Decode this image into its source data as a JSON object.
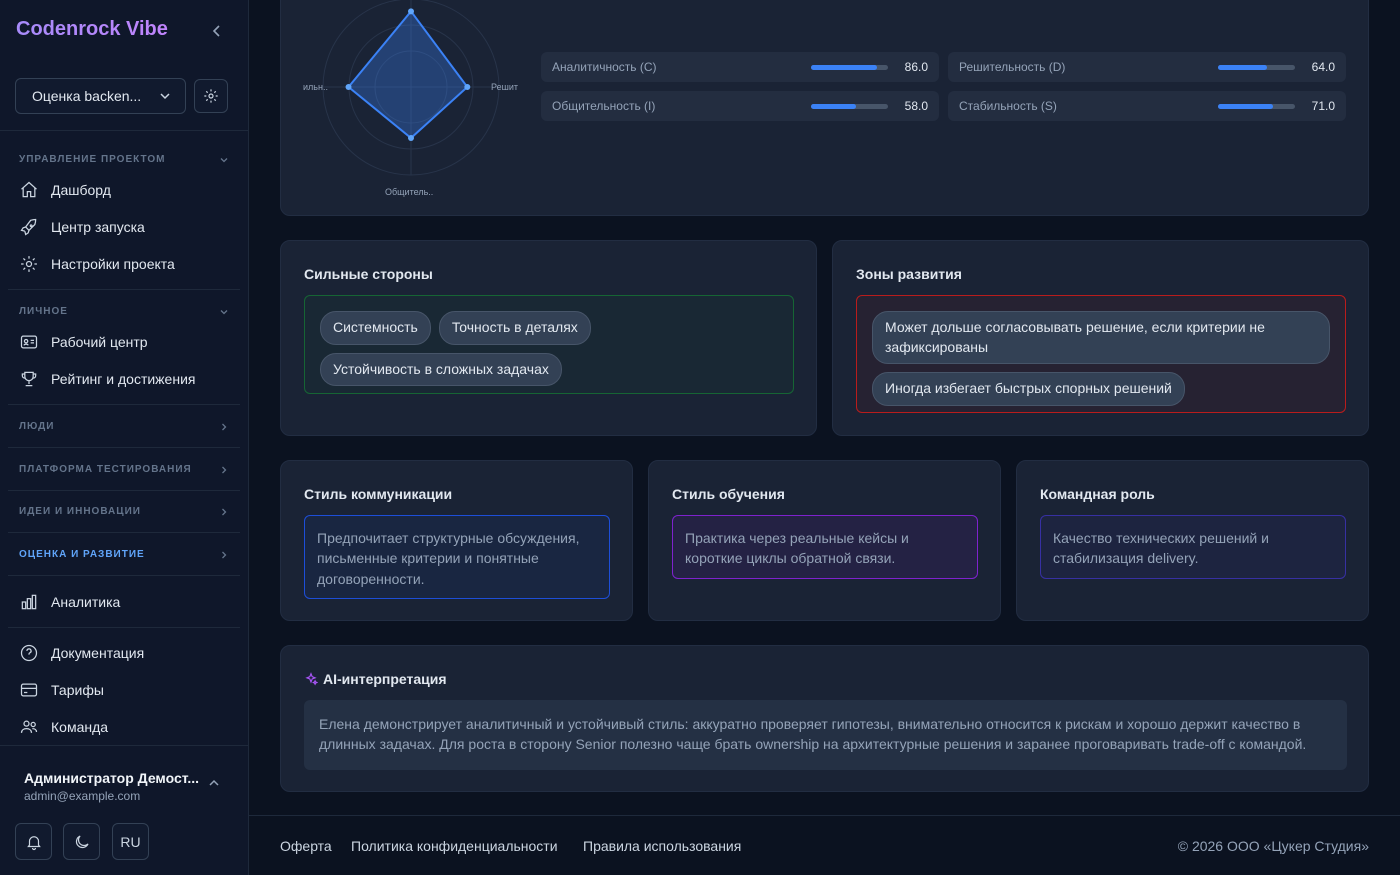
{
  "app": {
    "brand": "Codenrock Vibe"
  },
  "sidebar": {
    "project_select": "Оценка backen...",
    "sections": [
      {
        "title": "Управление проектом"
      },
      {
        "title": "Личное"
      },
      {
        "title": "Люди"
      },
      {
        "title": "Платформа тестирования"
      },
      {
        "title": "Идеи и инновации"
      },
      {
        "title": "Оценка и развитие"
      }
    ],
    "items": {
      "dashboard": "Дашборд",
      "launch": "Центр запуска",
      "project_settings": "Настройки проекта",
      "workspace": "Рабочий центр",
      "rating": "Рейтинг и достижения",
      "analytics": "Аналитика",
      "docs": "Документация",
      "tariffs": "Тарифы",
      "team": "Команда"
    },
    "user": {
      "name": "Администратор Демост...",
      "email": "admin@example.com"
    },
    "lang": "RU"
  },
  "radar": {
    "labels": {
      "left": "ильн..",
      "right": "Решит",
      "bottom": "Общитель.."
    },
    "values": {
      "analytic": 86.0,
      "decisive": 64.0,
      "sociable": 58.0,
      "stable": 71.0
    }
  },
  "metrics": [
    {
      "label": "Аналитичность (C)",
      "value": "86.0",
      "percent": 86
    },
    {
      "label": "Решительность (D)",
      "value": "64.0",
      "percent": 64
    },
    {
      "label": "Общительность (I)",
      "value": "58.0",
      "percent": 58
    },
    {
      "label": "Стабильность (S)",
      "value": "71.0",
      "percent": 71
    }
  ],
  "strengths": {
    "title": "Сильные стороны",
    "tags": [
      "Системность",
      "Точность в деталях",
      "Устойчивость в сложных задачах"
    ]
  },
  "growth": {
    "title": "Зоны развития",
    "tags": [
      "Может дольше согласовывать решение, если критерии не зафиксированы",
      "Иногда избегает быстрых спорных решений"
    ]
  },
  "communication": {
    "title": "Стиль коммуникации",
    "text": "Предпочитает структурные обсуждения, письменные критерии и понятные договоренности."
  },
  "learning": {
    "title": "Стиль обучения",
    "text": "Практика через реальные кейсы и короткие циклы обратной связи."
  },
  "team_role": {
    "title": "Командная роль",
    "text": "Качество технических решений и стабилизация delivery."
  },
  "ai": {
    "title": "AI-интерпретация",
    "text": "Елена демонстрирует аналитичный и устойчивый стиль: аккуратно проверяет гипотезы, внимательно относится к рискам и хорошо держит качество в длинных задачах. Для роста в сторону Senior полезно чаще брать ownership на архитектурные решения и заранее проговаривать trade-off с командой."
  },
  "footer": {
    "offer": "Оферта",
    "privacy": "Политика конфиденциальности",
    "rules": "Правила использования",
    "copyright": "© 2026 ООО «Цукер Студия»"
  },
  "colors": {
    "accent": "#3b82f6",
    "brand": "#a78bfa",
    "strength_border": "#16a34a",
    "growth_border": "#dc2626"
  }
}
